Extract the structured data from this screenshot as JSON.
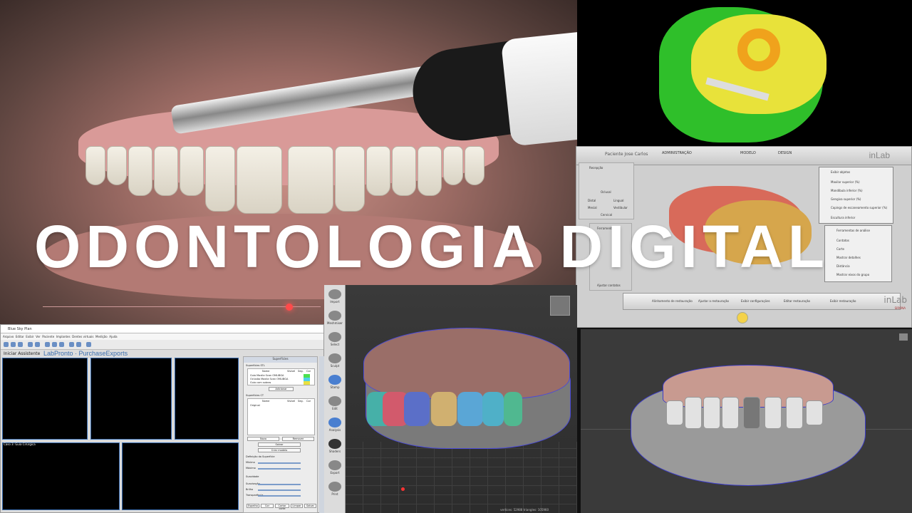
{
  "title": "ODONTOLOGIA DIGITAL",
  "inlab": {
    "patient": "Paciente Jose Carlos",
    "logo": "inLab",
    "tabs": [
      "ADMINISTRAÇÃO",
      "MODELO",
      "DESIGN"
    ],
    "left_panel_title": "Recepção",
    "left_options": [
      "Oclusal",
      "Lingual",
      "Distal",
      "Mesial",
      "Vestibular",
      "Cervical"
    ],
    "left_panel2_title": "Ferramentas",
    "left_panel2_item": "Ajustar contatos",
    "right_panel_title": "Exibir objetos",
    "right_items": [
      "Maxilar superior (%)",
      "Mandíbula inferior (%)",
      "Gengiva superior (%)",
      "Copings de escaneamento superior (%)",
      "Escultura inferior"
    ],
    "right_panel2_title": "Ferramentas de análise",
    "right2_items": [
      "Contatos",
      "Corte",
      "Mostrar detalhes",
      "Distância",
      "Mostrar eixos do grupo"
    ],
    "steps": [
      "Alinhamento de restauração",
      "Ajustar a restauração",
      "Exibir configurações",
      "Editar restauração",
      "Exibir restauração"
    ],
    "logo_bottom": "inLab",
    "logo_sub": "SIRONA"
  },
  "bsp": {
    "window_title": "Blue Sky Plan",
    "menu": [
      "Arquivo",
      "Editar",
      "Exibir",
      "Ver",
      "Paciente",
      "Implantes",
      "Dentes virtuais",
      "Medição",
      "Ajuda"
    ],
    "start": "Iniciar Assistente",
    "brand": "LabPronto · PurchaseExports",
    "panel_title": "Superfícies",
    "stl_header": "Superfícies STL",
    "stl_cols": [
      "Nome",
      "Visível",
      "Seg.",
      "Cor"
    ],
    "stl_rows": [
      "Guia Maxila Scan OMLIBGA",
      "Oclusão Maxila Scan OMLIBGA",
      "Guia com sobras"
    ],
    "ct_header": "Superfícies CT",
    "ct_cols": [
      "Nome",
      "Visível",
      "Seg.",
      "Cor"
    ],
    "ct_rows": [
      "Original"
    ],
    "buttons": [
      "Adicionar",
      "Excluir",
      "Novo",
      "Remover",
      "Salvar",
      "Limpar",
      "Criar modelo",
      "Baixar",
      "Carregar"
    ],
    "section": "Definição da Superfície",
    "sliders": [
      "Mínimo",
      "Máximo",
      "Suavidade",
      "Suavização",
      "Brilho",
      "Transparência"
    ],
    "options": [
      "Espelho",
      "Cor",
      "Cortar corte",
      "Limpar",
      "Salvar"
    ],
    "status": "Caso 3: Guia Cirúrgica"
  },
  "modeller": {
    "tools": [
      "Import",
      "Meshmixer",
      "Select",
      "Sculpt",
      "Stamp",
      "Edit",
      "Analysis",
      "Shaders",
      "Export",
      "Print"
    ],
    "status": "vertices: 52988 triangles: 105960"
  },
  "colors": {
    "accent": "#3b6fb0",
    "guide_green": "#2fbf2a",
    "guide_yellow": "#e8e23a",
    "guide_orange": "#f0a21c"
  }
}
